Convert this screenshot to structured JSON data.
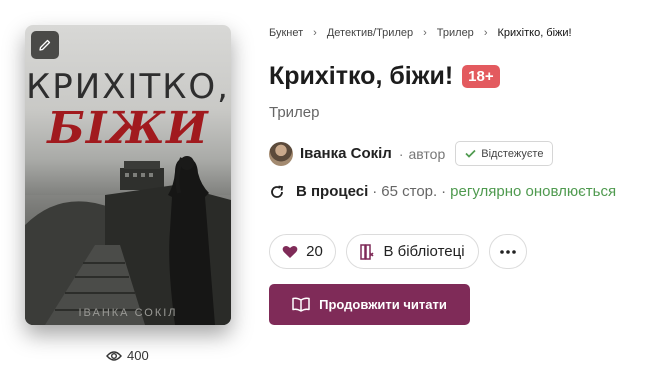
{
  "cover": {
    "title_line1": "КРИХІТКО,",
    "title_line2": "БІЖИ",
    "author": "ІВАНКА СОКІЛ",
    "edit_icon": "pencil-icon",
    "accent_color": "#a11a1e"
  },
  "views": {
    "count": "400",
    "icon": "eye-icon"
  },
  "breadcrumb": [
    {
      "label": "Букнет"
    },
    {
      "label": "Детектив/Трилер"
    },
    {
      "label": "Трилер"
    },
    {
      "label": "Крихітко, біжи!"
    }
  ],
  "book": {
    "title": "Крихітко, біжи!",
    "age_rating": "18+",
    "genre": "Трилер"
  },
  "author": {
    "name": "Іванка Сокіл",
    "role": "автор",
    "follow_label": "Відстежуєте",
    "follow_icon": "check-icon"
  },
  "status": {
    "icon": "refresh-icon",
    "state": "В процесі",
    "pages": "65 стор.",
    "updates": "регулярно оновлюється",
    "updates_color": "#4f9a4f"
  },
  "actions": {
    "likes_count": "20",
    "likes_icon": "heart-icon",
    "library_label": "В бібліотеці",
    "library_icon": "library-icon",
    "more_icon": "more-dots-icon"
  },
  "read_button": {
    "label": "Продовжити читати",
    "icon": "open-book-icon",
    "color": "#7f2b58"
  }
}
